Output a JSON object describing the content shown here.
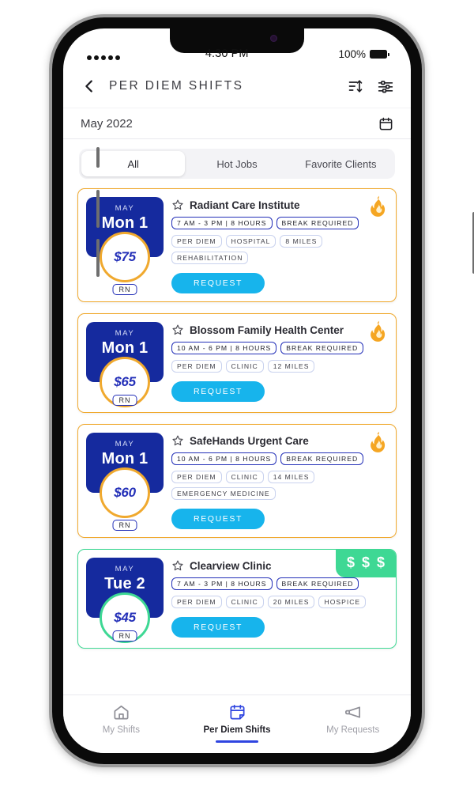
{
  "status_bar": {
    "signal_dots": 5,
    "time": "4:30 PM",
    "battery_percent": "100%",
    "battery_icon": "battery-full-icon"
  },
  "header": {
    "back_icon": "chevron-left-icon",
    "title": "PER DIEM SHIFTS",
    "sort_icon": "sort-icon",
    "filter_icon": "filter-sliders-icon"
  },
  "month_row": {
    "label": "May 2022",
    "calendar_icon": "calendar-icon"
  },
  "tabs": [
    {
      "label": "All",
      "active": true
    },
    {
      "label": "Hot Jobs",
      "active": false
    },
    {
      "label": "Favorite Clients",
      "active": false
    }
  ],
  "shifts": [
    {
      "month": "MAY",
      "day": "Mon 1",
      "price": "$75",
      "role": "RN",
      "facility": "Radiant Care Institute",
      "badge": "hot",
      "badge_icon": "fire-icon",
      "badge_text": "",
      "star_icon": "star-outline-icon",
      "accent": "#f0a92e",
      "tags_strong": [
        "7 AM - 3 PM | 8 HOURS",
        "BREAK REQUIRED"
      ],
      "tags_light": [
        "PER DIEM",
        "HOSPITAL",
        "8 MILES",
        "REHABILITATION"
      ],
      "request_label": "REQUEST"
    },
    {
      "month": "MAY",
      "day": "Mon 1",
      "price": "$65",
      "role": "RN",
      "facility": "Blossom Family Health Center",
      "badge": "hot",
      "badge_icon": "fire-icon",
      "badge_text": "",
      "star_icon": "star-outline-icon",
      "accent": "#f0a92e",
      "tags_strong": [
        "10 AM - 6 PM | 8 HOURS",
        "BREAK REQUIRED"
      ],
      "tags_light": [
        "PER DIEM",
        "CLINIC",
        "12 MILES"
      ],
      "request_label": "REQUEST"
    },
    {
      "month": "MAY",
      "day": "Mon 1",
      "price": "$60",
      "role": "RN",
      "facility": "SafeHands Urgent Care",
      "badge": "hot",
      "badge_icon": "fire-icon",
      "badge_text": "",
      "star_icon": "star-outline-icon",
      "accent": "#f0a92e",
      "tags_strong": [
        "10 AM - 6 PM | 8 HOURS",
        "BREAK REQUIRED"
      ],
      "tags_light": [
        "PER DIEM",
        "CLINIC",
        "14 MILES",
        "EMERGENCY MEDICINE"
      ],
      "request_label": "REQUEST"
    },
    {
      "month": "MAY",
      "day": "Tue 2",
      "price": "$45",
      "role": "RN",
      "facility": "Clearview Clinic",
      "badge": "pay",
      "badge_icon": "dollar-badge",
      "badge_text": "$ $ $",
      "star_icon": "star-outline-icon",
      "accent": "#3ed894",
      "tags_strong": [
        "7 AM - 3 PM | 8 HOURS",
        "BREAK REQUIRED"
      ],
      "tags_light": [
        "PER DIEM",
        "CLINIC",
        "20 MILES",
        "HOSPICE"
      ],
      "request_label": "REQUEST"
    }
  ],
  "bottom_nav": [
    {
      "label": "My Shifts",
      "icon": "home-icon",
      "active": false
    },
    {
      "label": "Per Diem Shifts",
      "icon": "calendar-shift-icon",
      "active": true
    },
    {
      "label": "My Requests",
      "icon": "megaphone-icon",
      "active": false
    }
  ],
  "colors": {
    "brand_blue": "#152a9e",
    "action_blue": "#17b4ec",
    "hot_orange": "#f0a92e",
    "pay_green": "#3ed894",
    "nav_active": "#2f45e0"
  }
}
